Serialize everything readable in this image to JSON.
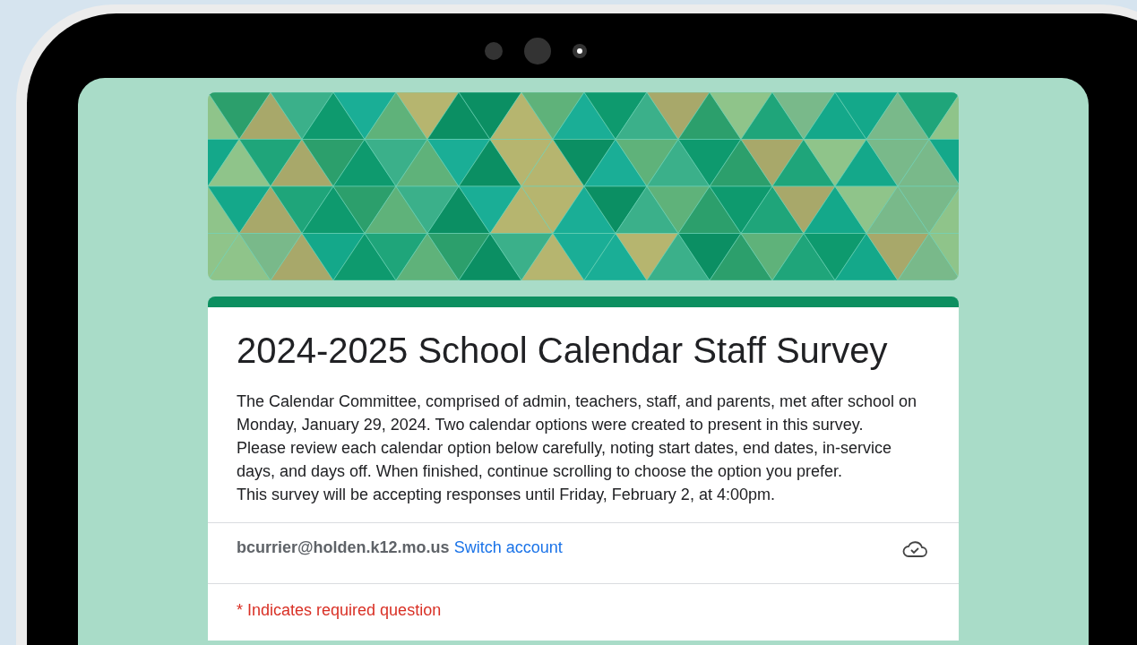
{
  "form": {
    "title": "2024-2025 School Calendar Staff Survey",
    "description": [
      "The Calendar Committee, comprised of admin, teachers, staff, and parents, met after school on Monday, January 29, 2024. Two calendar options were created to present in this survey.",
      "Please review each calendar option below carefully, noting start dates, end dates, in-service days, and days off. When finished, continue scrolling to choose the option you prefer.",
      "This survey will be accepting responses until Friday, February 2, at 4:00pm."
    ],
    "account": {
      "email": "bcurrier@holden.k12.mo.us",
      "switch_link": "Switch account"
    },
    "required_note": "* Indicates required question"
  }
}
